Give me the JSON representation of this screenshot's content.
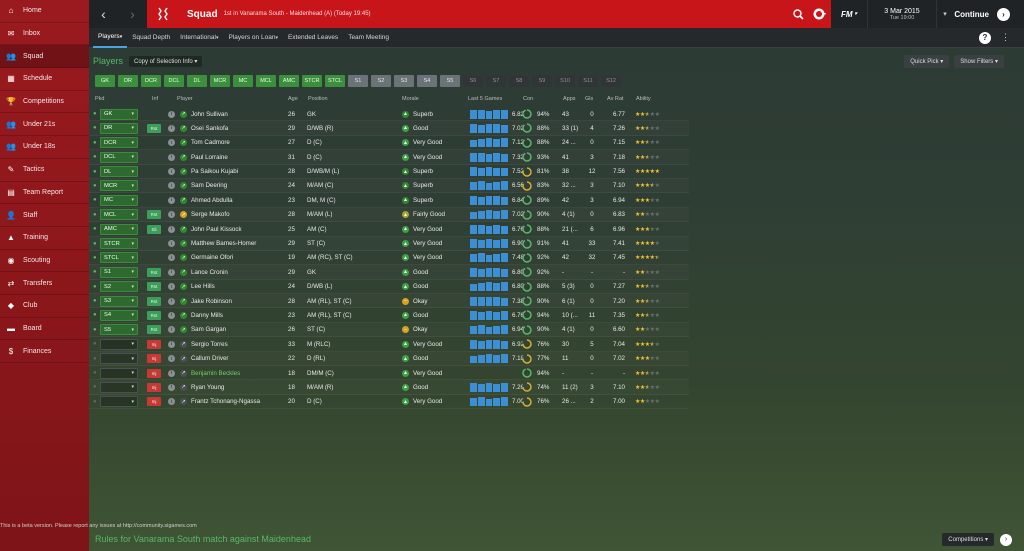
{
  "sidebar": {
    "items": [
      {
        "label": "Home",
        "icon": "home-icon",
        "glyph": "⌂"
      },
      {
        "label": "Inbox",
        "icon": "inbox-icon",
        "glyph": "✉"
      },
      {
        "label": "Squad",
        "icon": "squad-icon",
        "glyph": "👥"
      },
      {
        "label": "Schedule",
        "icon": "schedule-icon",
        "glyph": "▦"
      },
      {
        "label": "Competitions",
        "icon": "trophy-icon",
        "glyph": "🏆"
      },
      {
        "label": "Under 21s",
        "icon": "squad-icon",
        "glyph": "👥"
      },
      {
        "label": "Under 18s",
        "icon": "squad-icon",
        "glyph": "👥"
      },
      {
        "label": "Tactics",
        "icon": "tactics-icon",
        "glyph": "✎"
      },
      {
        "label": "Team Report",
        "icon": "report-icon",
        "glyph": "▤"
      },
      {
        "label": "Staff",
        "icon": "staff-icon",
        "glyph": "👤"
      },
      {
        "label": "Training",
        "icon": "training-icon",
        "glyph": "▲"
      },
      {
        "label": "Scouting",
        "icon": "scouting-icon",
        "glyph": "◉"
      },
      {
        "label": "Transfers",
        "icon": "transfers-icon",
        "glyph": "⇄"
      },
      {
        "label": "Club",
        "icon": "club-icon",
        "glyph": "◆"
      },
      {
        "label": "Board",
        "icon": "board-icon",
        "glyph": "▬"
      },
      {
        "label": "Finances",
        "icon": "finances-icon",
        "glyph": "$"
      }
    ]
  },
  "topbar": {
    "title": "Squad",
    "subtitle": "1st in Vanarama South - Maidenhead (A) (Today 19:45)",
    "fm_label": "FM",
    "date_line1": "3 Mar 2015",
    "date_line2": "Tue 19:00",
    "continue_label": "Continue"
  },
  "tabs": [
    "Players",
    "Squad Depth",
    "International",
    "Players on Loan",
    "Extended Leaves",
    "Team Meeting"
  ],
  "page": {
    "title": "Players",
    "view_select": "Copy of Selection Info",
    "quick_pick": "Quick Pick",
    "show_filters": "Show Filters"
  },
  "positions": [
    {
      "label": "GK",
      "style": "green"
    },
    {
      "label": "DR",
      "style": "green"
    },
    {
      "label": "DCR",
      "style": "green"
    },
    {
      "label": "DCL",
      "style": "green"
    },
    {
      "label": "DL",
      "style": "green"
    },
    {
      "label": "MCR",
      "style": "green"
    },
    {
      "label": "MC",
      "style": "green"
    },
    {
      "label": "MCL",
      "style": "green"
    },
    {
      "label": "AMC",
      "style": "green"
    },
    {
      "label": "STCR",
      "style": "green"
    },
    {
      "label": "STCL",
      "style": "green"
    },
    {
      "label": "S1",
      "style": "grey"
    },
    {
      "label": "S2",
      "style": "grey"
    },
    {
      "label": "S3",
      "style": "grey"
    },
    {
      "label": "S4",
      "style": "grey"
    },
    {
      "label": "S5",
      "style": "grey"
    },
    {
      "label": "S6",
      "style": "dark"
    },
    {
      "label": "S7",
      "style": "dark"
    },
    {
      "label": "S8",
      "style": "dark"
    },
    {
      "label": "S9",
      "style": "dark"
    },
    {
      "label": "S10",
      "style": "dark"
    },
    {
      "label": "S11",
      "style": "dark"
    },
    {
      "label": "S12",
      "style": "dark"
    }
  ],
  "columns": {
    "pkd": "Pkd",
    "inf": "Inf",
    "player": "Player",
    "age": "Age",
    "position": "Position",
    "morale": "Morale",
    "last5": "Last 5 Games",
    "con": "Con",
    "apps": "Apps",
    "gls": "Gls",
    "avrat": "Av Rat",
    "ability": "Ability"
  },
  "players": [
    {
      "pkd": "GK",
      "inf": "",
      "name": "John Sullivan",
      "age": "26",
      "position": "GK",
      "morale": "Superb",
      "rating": "6.82",
      "con": "94%",
      "apps": "43",
      "gls": "0",
      "avr": "6.77",
      "stars": 2.5
    },
    {
      "pkd": "DR",
      "inf": "Rst",
      "name": "Osei Sankofa",
      "age": "29",
      "position": "D/WB (R)",
      "morale": "Good",
      "rating": "7.02",
      "con": "88%",
      "apps": "33 (1)",
      "gls": "4",
      "avr": "7.26",
      "stars": 2.5
    },
    {
      "pkd": "DCR",
      "inf": "",
      "name": "Tom Cadmore",
      "age": "27",
      "position": "D (C)",
      "morale": "Very Good",
      "rating": "7.12",
      "con": "88%",
      "apps": "24 ...",
      "gls": "0",
      "avr": "7.15",
      "stars": 2.5
    },
    {
      "pkd": "DCL",
      "inf": "",
      "name": "Paul Lorraine",
      "age": "31",
      "position": "D (C)",
      "morale": "Very Good",
      "rating": "7.32",
      "con": "93%",
      "apps": "41",
      "gls": "3",
      "avr": "7.18",
      "stars": 2.5
    },
    {
      "pkd": "DL",
      "inf": "",
      "name": "Pa Saikou Kujabi",
      "age": "28",
      "position": "D/WB/M (L)",
      "morale": "Superb",
      "rating": "7.52",
      "con": "81%",
      "apps": "38",
      "gls": "12",
      "avr": "7.56",
      "stars": 5
    },
    {
      "pkd": "MCR",
      "inf": "",
      "name": "Sam Deering",
      "age": "24",
      "position": "M/AM (C)",
      "morale": "Superb",
      "rating": "6.56",
      "con": "83%",
      "apps": "32 ...",
      "gls": "3",
      "avr": "7.10",
      "stars": 3.5
    },
    {
      "pkd": "MC",
      "inf": "",
      "name": "Ahmed Abdulla",
      "age": "23",
      "position": "DM, M (C)",
      "morale": "Superb",
      "rating": "6.84",
      "con": "89%",
      "apps": "42",
      "gls": "3",
      "avr": "6.94",
      "stars": 3
    },
    {
      "pkd": "MCL",
      "inf": "Rst",
      "name": "Serge Makofo",
      "age": "28",
      "position": "M/AM (L)",
      "morale": "Fairly Good",
      "rating": "7.02",
      "con": "90%",
      "apps": "4 (1)",
      "gls": "0",
      "avr": "6.83",
      "stars": 2
    },
    {
      "pkd": "AMC",
      "inf": "Sli",
      "name": "John Paul Kissock",
      "age": "25",
      "position": "AM (C)",
      "morale": "Very Good",
      "rating": "6.76",
      "con": "88%",
      "apps": "21 (...",
      "gls": "6",
      "avr": "6.96",
      "stars": 3
    },
    {
      "pkd": "STCR",
      "inf": "",
      "name": "Matthew Barnes-Homer",
      "age": "29",
      "position": "ST (C)",
      "morale": "Very Good",
      "rating": "6.90",
      "con": "91%",
      "apps": "41",
      "gls": "33",
      "avr": "7.41",
      "stars": 4
    },
    {
      "pkd": "STCL",
      "inf": "",
      "name": "Germaine Ofori",
      "age": "19",
      "position": "AM (RC), ST (C)",
      "morale": "Very Good",
      "rating": "7.48",
      "con": "92%",
      "apps": "42",
      "gls": "32",
      "avr": "7.45",
      "stars": 4.5
    },
    {
      "pkd": "S1",
      "inf": "Rst",
      "name": "Lance Cronin",
      "age": "29",
      "position": "GK",
      "morale": "Good",
      "rating": "6.80",
      "con": "92%",
      "apps": "-",
      "gls": "-",
      "avr": "-",
      "stars": 2
    },
    {
      "pkd": "S2",
      "inf": "Rst",
      "name": "Lee Hills",
      "age": "24",
      "position": "D/WB (L)",
      "morale": "Good",
      "rating": "6.80",
      "con": "88%",
      "apps": "5 (3)",
      "gls": "0",
      "avr": "7.27",
      "stars": 2.5
    },
    {
      "pkd": "S3",
      "inf": "Rst",
      "name": "Jake Robinson",
      "age": "28",
      "position": "AM (RL), ST (C)",
      "morale": "Okay",
      "rating": "7.38",
      "con": "90%",
      "apps": "6 (1)",
      "gls": "0",
      "avr": "7.20",
      "stars": 2.5
    },
    {
      "pkd": "S4",
      "inf": "Rst",
      "name": "Danny Mills",
      "age": "23",
      "position": "AM (RL), ST (C)",
      "morale": "Good",
      "rating": "6.76",
      "con": "94%",
      "apps": "10 (...",
      "gls": "11",
      "avr": "7.35",
      "stars": 2.5
    },
    {
      "pkd": "S5",
      "inf": "Rst",
      "name": "Sam Gargan",
      "age": "26",
      "position": "ST (C)",
      "morale": "Okay",
      "rating": "6.94",
      "con": "90%",
      "apps": "4 (1)",
      "gls": "0",
      "avr": "6.60",
      "stars": 2
    },
    {
      "pkd": "",
      "inf": "Inj",
      "name": "Sergio Torres",
      "age": "33",
      "position": "M (RLC)",
      "morale": "Very Good",
      "rating": "6.92",
      "con": "76%",
      "apps": "30",
      "gls": "5",
      "avr": "7.04",
      "stars": 3.5
    },
    {
      "pkd": "",
      "inf": "Inj",
      "name": "Callum Driver",
      "age": "22",
      "position": "D (RL)",
      "morale": "Good",
      "rating": "7.18",
      "con": "77%",
      "apps": "11",
      "gls": "0",
      "avr": "7.02",
      "stars": 3
    },
    {
      "pkd": "",
      "inf": "Inj",
      "name": "Benjamin Beckles",
      "age": "18",
      "position": "DM/M (C)",
      "morale": "Very Good",
      "rating": "",
      "con": "94%",
      "apps": "-",
      "gls": "-",
      "avr": "-",
      "stars": 2.5
    },
    {
      "pkd": "",
      "inf": "Inj",
      "name": "Ryan Young",
      "age": "18",
      "position": "M/AM (R)",
      "morale": "Good",
      "rating": "7.26",
      "con": "74%",
      "apps": "11 (2)",
      "gls": "3",
      "avr": "7.10",
      "stars": 2.5
    },
    {
      "pkd": "",
      "inf": "Inj",
      "name": "Frantz Tchonang-Ngassa",
      "age": "20",
      "position": "D (C)",
      "morale": "Very Good",
      "rating": "7.00",
      "con": "76%",
      "apps": "26 ...",
      "gls": "2",
      "avr": "7.00",
      "stars": 2
    }
  ],
  "footer": {
    "beta_text": "This is a beta version. Please report any issues at http://community.sigames.com",
    "rules_text": "Rules for Vanarama South match against Maidenhead",
    "competitions_label": "Competitions"
  },
  "colors": {
    "sidebar": "#8b171b",
    "topbar_red": "#c8151a",
    "accent_green": "#58b868",
    "bar_blue": "#3d8fd4",
    "star": "#f0c431"
  }
}
